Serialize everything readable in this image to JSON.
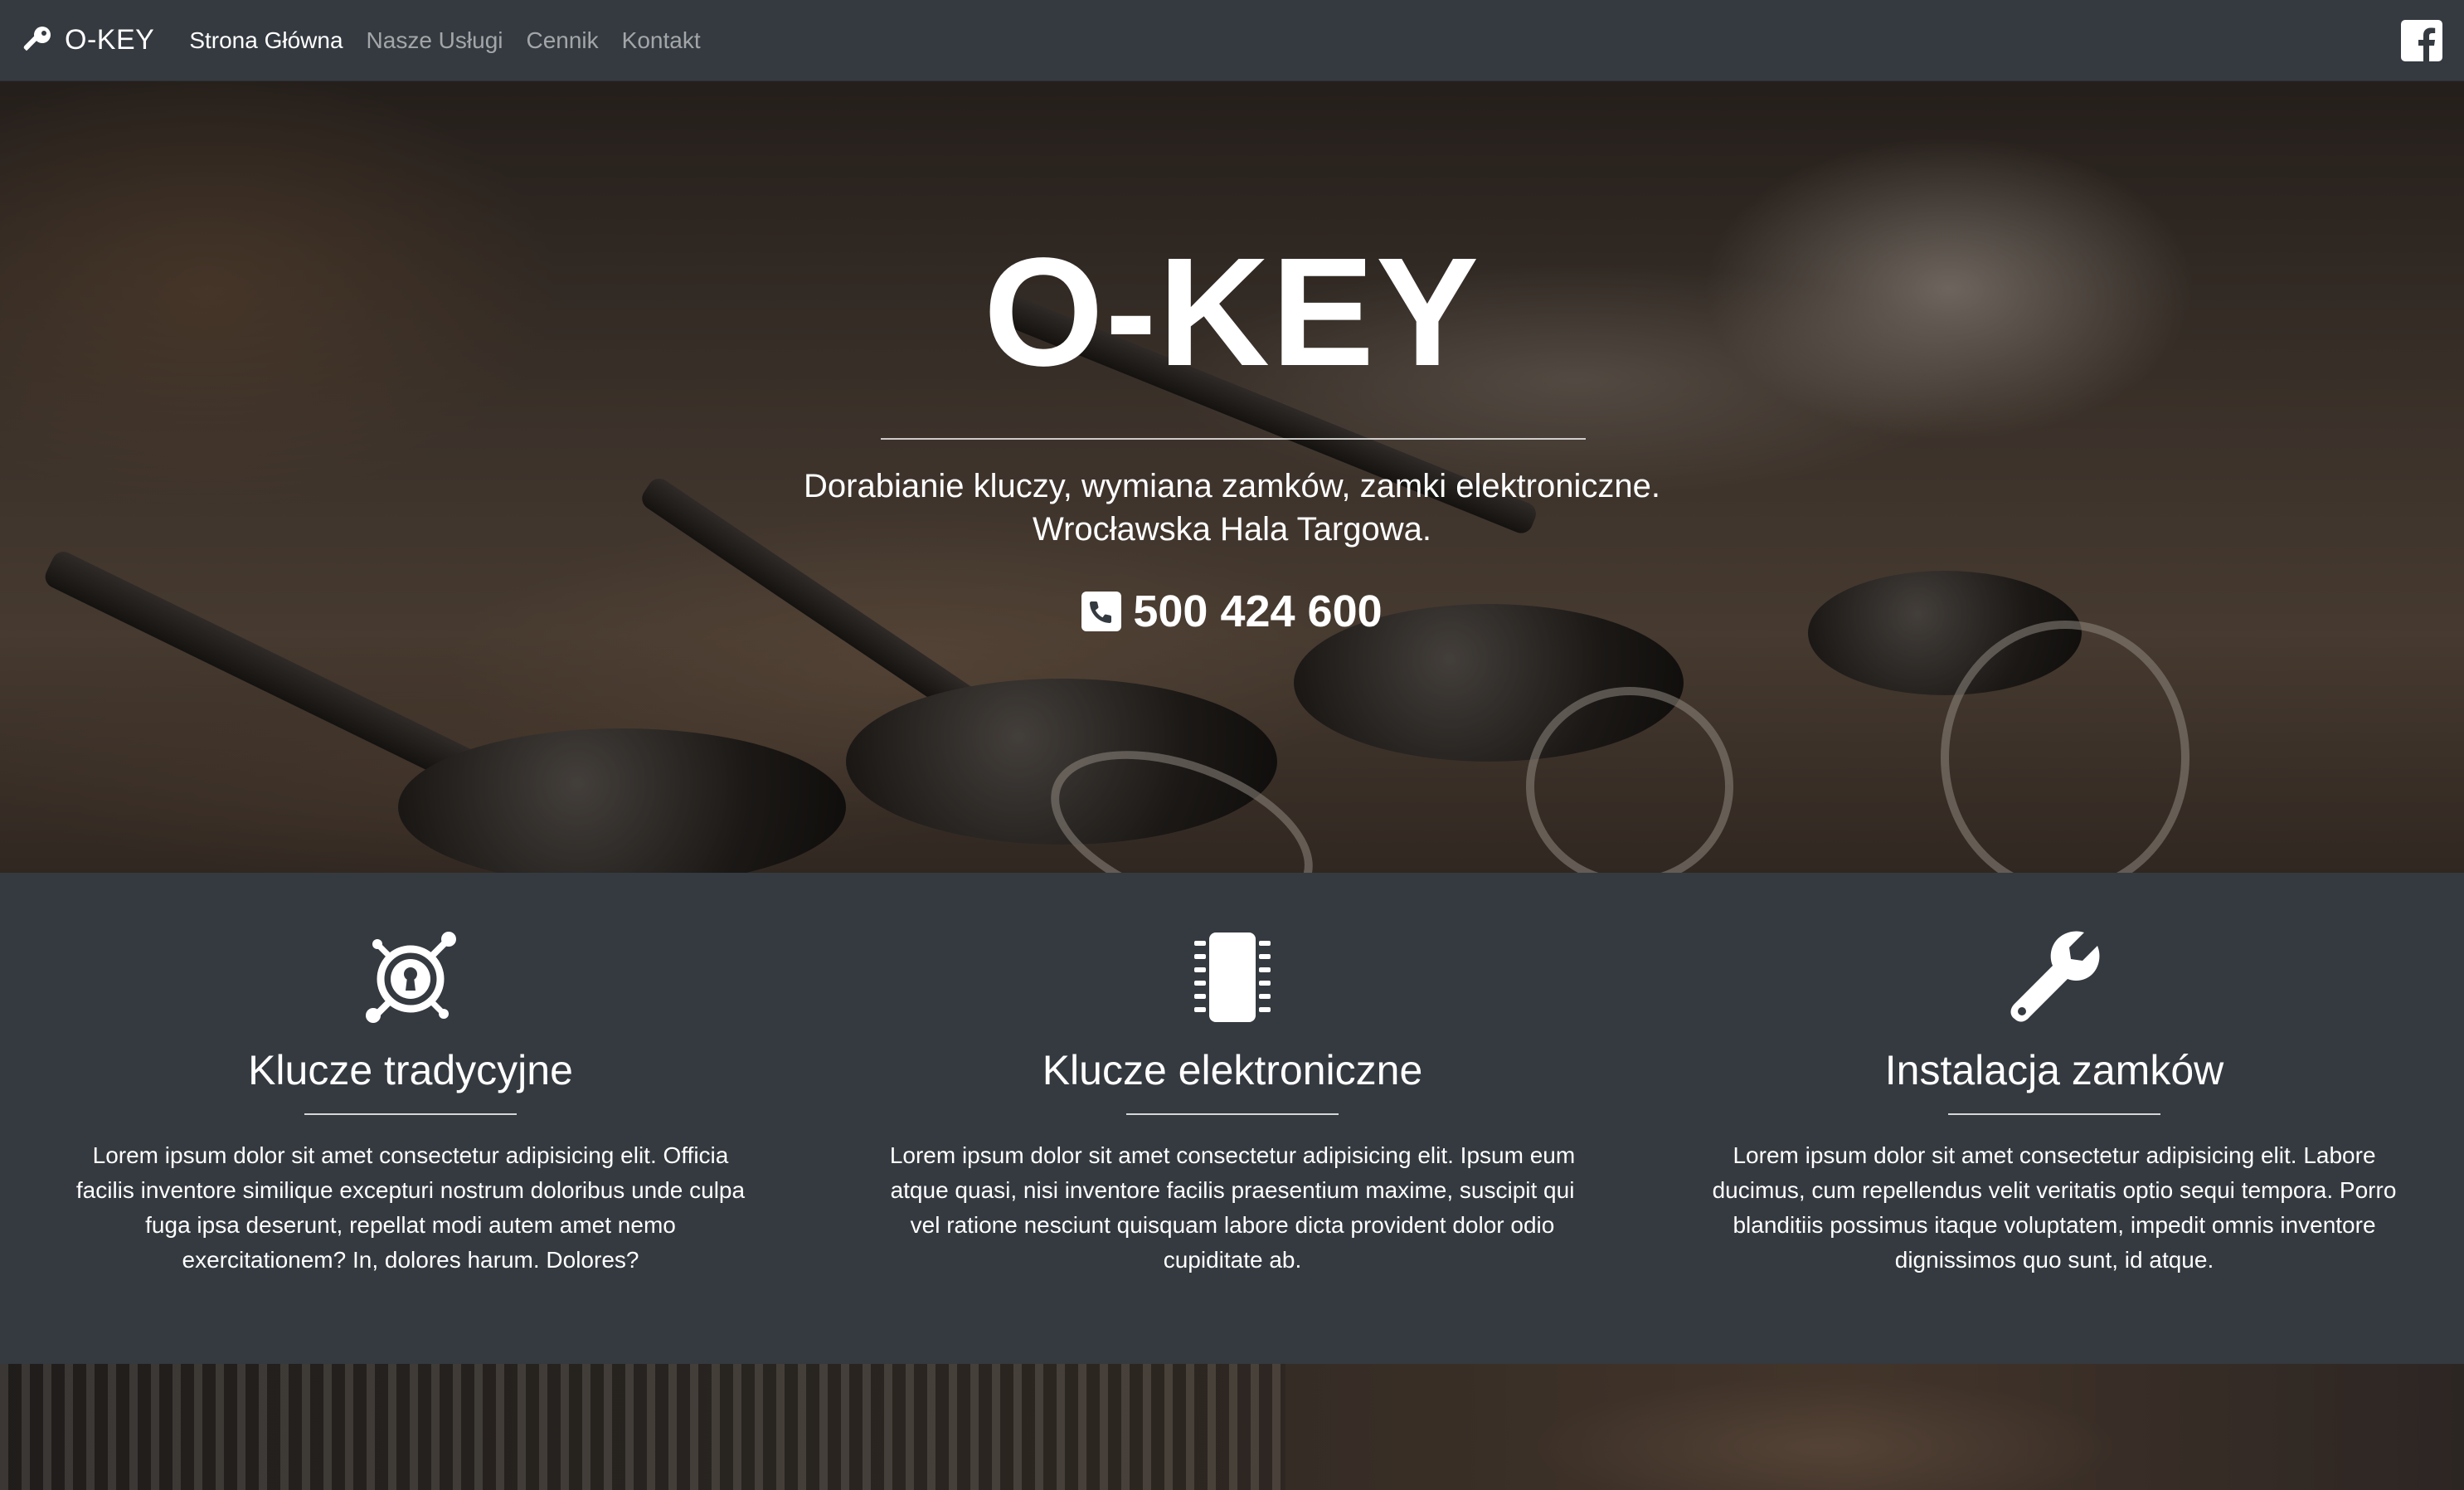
{
  "navbar": {
    "brand": "O-KEY",
    "links": [
      {
        "label": "Strona Główna",
        "active": true
      },
      {
        "label": "Nasze Usługi",
        "active": false
      },
      {
        "label": "Cennik",
        "active": false
      },
      {
        "label": "Kontakt",
        "active": false
      }
    ],
    "social_icon": "facebook-icon"
  },
  "hero": {
    "title": "O-KEY",
    "subtitle_line1": "Dorabianie kluczy, wymiana zamków, zamki elektroniczne.",
    "subtitle_line2": "Wrocławska Hala Targowa.",
    "phone": "500 424 600",
    "phone_icon": "phone-square-icon"
  },
  "services": [
    {
      "icon": "keycdn-icon",
      "title": "Klucze tradycyjne",
      "text": "Lorem ipsum dolor sit amet consectetur adipisicing elit. Officia facilis inventore similique excepturi nostrum doloribus unde culpa fuga ipsa deserunt, repellat modi autem amet nemo exercitationem? In, dolores harum. Dolores?"
    },
    {
      "icon": "microchip-icon",
      "title": "Klucze elektroniczne",
      "text": "Lorem ipsum dolor sit amet consectetur adipisicing elit. Ipsum eum atque quasi, nisi inventore facilis praesentium maxime, suscipit qui vel ratione nesciunt quisquam labore dicta provident dolor odio cupiditate ab."
    },
    {
      "icon": "wrench-icon",
      "title": "Instalacja zamków",
      "text": "Lorem ipsum dolor sit amet consectetur adipisicing elit. Labore ducimus, cum repellendus velit veritatis optio sequi tempora. Porro blanditiis possimus itaque voluptatem, impedit omnis inventore dignissimos quo sunt, id atque."
    }
  ],
  "colors": {
    "navbar_bg": "#343a40",
    "services_bg": "#343a40",
    "text": "#ffffff",
    "nav_inactive": "rgba(255,255,255,0.55)"
  }
}
